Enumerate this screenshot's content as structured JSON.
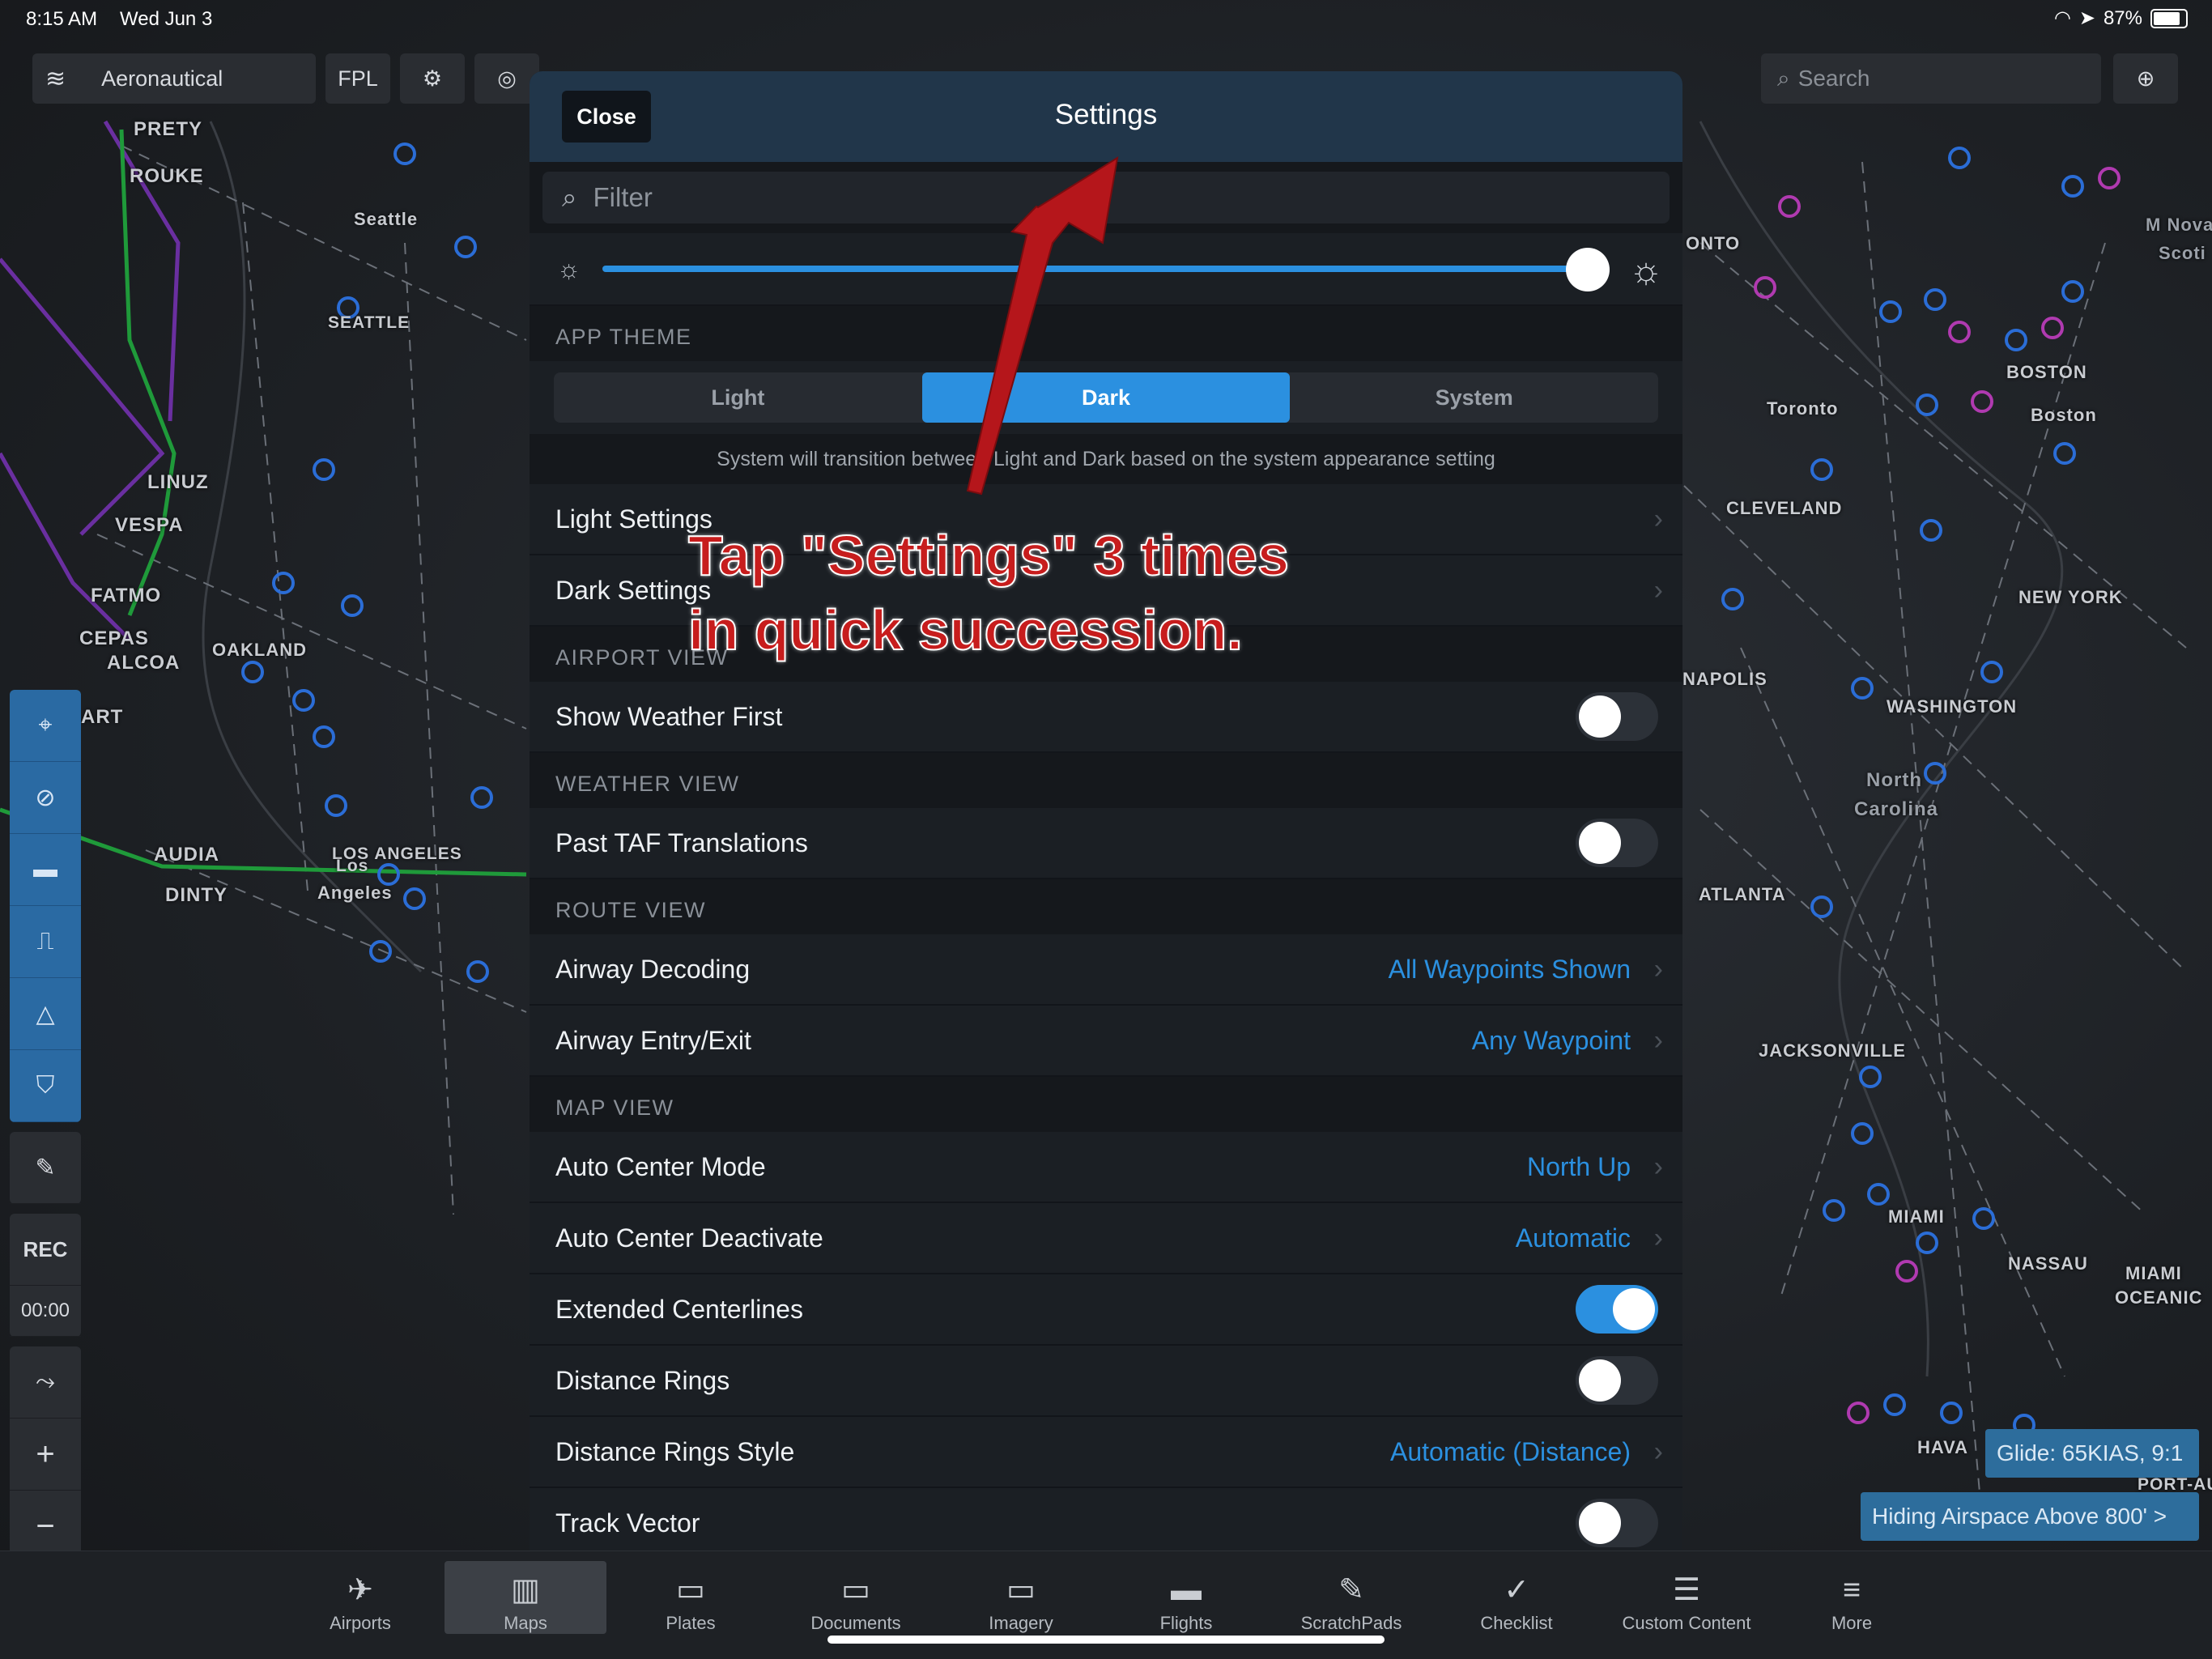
{
  "status_bar": {
    "time": "8:15 AM",
    "date": "Wed Jun 3",
    "battery": "87%"
  },
  "toolbar": {
    "layer_label": "Aeronautical",
    "fpl_label": "FPL",
    "search_placeholder": "Search"
  },
  "map_labels": [
    "PRETY",
    "ROUKE",
    "Seattle",
    "SEATTLE",
    "LINUZ",
    "VESPA",
    "FATMO",
    "CEPAS",
    "ALCOA",
    "OAKLAND",
    "ART",
    "AUDIA",
    "DINTY",
    "LOS ANGELES",
    "Los",
    "Angeles",
    "ONTO",
    "Toronto",
    "BOSTON",
    "Boston",
    "CLEVELAND",
    "NEW YORK",
    "NAPOLIS",
    "WASHINGTON",
    "North",
    "Carolina",
    "ATLANTA",
    "JACKSONVILLE",
    "MIAMI",
    "NASSAU",
    "MIAMI",
    "OCEANIC",
    "HAVA",
    "PORT-AU",
    "M Nova",
    "Scoti"
  ],
  "sidebar": {
    "rec_label": "REC",
    "timer": "00:00",
    "plus": "+",
    "minus": "−"
  },
  "modal": {
    "close_label": "Close",
    "title": "Settings",
    "filter_placeholder": "Filter",
    "app_theme_header": "APP THEME",
    "theme_options": [
      "Light",
      "Dark",
      "System"
    ],
    "theme_selected": "Dark",
    "theme_note": "System will transition between Light and Dark based on the system appearance setting",
    "light_settings": "Light Settings",
    "dark_settings": "Dark Settings",
    "airport_view_header": "AIRPORT VIEW",
    "show_weather_first": "Show Weather First",
    "weather_view_header": "WEATHER VIEW",
    "past_taf": "Past TAF Translations",
    "route_view_header": "ROUTE VIEW",
    "airway_decoding": "Airway Decoding",
    "airway_decoding_value": "All Waypoints Shown",
    "airway_entry": "Airway Entry/Exit",
    "airway_entry_value": "Any Waypoint",
    "map_view_header": "MAP VIEW",
    "auto_center_mode": "Auto Center Mode",
    "auto_center_mode_value": "North Up",
    "auto_center_deactivate": "Auto Center Deactivate",
    "auto_center_deactivate_value": "Automatic",
    "extended_centerlines": "Extended Centerlines",
    "distance_rings": "Distance Rings",
    "distance_rings_style": "Distance Rings Style",
    "distance_rings_style_value": "Automatic (Distance)",
    "track_vector": "Track Vector",
    "toggles": {
      "show_weather_first": false,
      "past_taf": false,
      "extended_centerlines": true,
      "distance_rings": false,
      "track_vector": false
    }
  },
  "annotation": {
    "line1": "Tap \"Settings\" 3 times",
    "line2": "in quick succession."
  },
  "chips": {
    "glide": "Glide: 65KIAS, 9:1",
    "airspace": "Hiding Airspace Above 800' >"
  },
  "tabs": [
    "Airports",
    "Maps",
    "Plates",
    "Documents",
    "Imagery",
    "Flights",
    "ScratchPads",
    "Checklist",
    "Custom Content",
    "More"
  ],
  "active_tab": "Maps",
  "colors": {
    "accent": "#2b90e0",
    "annotation": "#c71d1d",
    "header": "#21364a"
  }
}
